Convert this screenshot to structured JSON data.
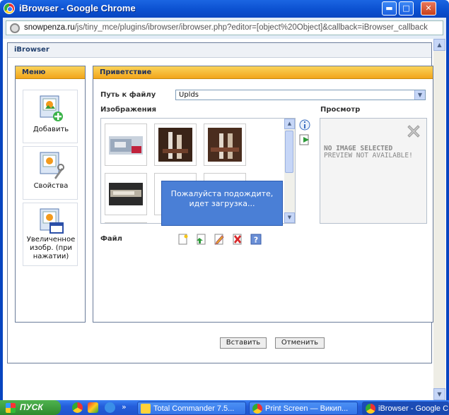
{
  "window": {
    "title": "iBrowser - Google Chrome",
    "url_host": "snowpenza.ru",
    "url_path": "/js/tiny_mce/plugins/ibrowser/ibrowser.php?editor=[object%20Object]&callback=iBrowser_callback",
    "min_glyph": "▬",
    "max_glyph": "□",
    "close_glyph": "✕"
  },
  "ibrowser": {
    "header": "iBrowser",
    "menu": {
      "title": "Меню",
      "items": [
        {
          "label": "Добавить",
          "icon": "add-image-icon"
        },
        {
          "label": "Свойства",
          "icon": "properties-icon"
        },
        {
          "label": "Увеличенное изобр. (при нажатии)",
          "icon": "enlarge-image-icon"
        }
      ]
    },
    "main": {
      "title": "Приветствие",
      "path_label": "Путь к файлу",
      "path_value": "Uplds",
      "images_label": "Изображения",
      "preview_label": "Просмотр",
      "preview_msg": "NO IMAGE SELECTED",
      "preview_msg2": "PREVIEW NOT AVAILABLE!",
      "file_label": "Файл",
      "loading": "Пожалуйста подождите, идет загрузка..."
    },
    "buttons": {
      "insert": "Вставить",
      "cancel": "Отменить"
    }
  },
  "taskbar": {
    "start": "пуск",
    "tasks": [
      {
        "label": "Total Commander 7.5...",
        "icon": "total-commander-icon"
      },
      {
        "label": "Print Screen — Викип...",
        "icon": "chrome-icon"
      },
      {
        "label": "iBrowser - Google C...",
        "icon": "chrome-icon"
      }
    ]
  },
  "colors": {
    "title_bar": "#0a4fcf",
    "panel_header": "#f2a51a",
    "loading_box": "#4a7fd6",
    "taskbar": "#245edb",
    "start_button": "#2d8a2d"
  }
}
